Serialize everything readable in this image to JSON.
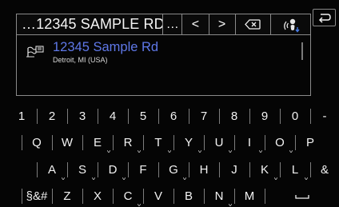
{
  "search": {
    "text": "…12345 SAMPLE RD ",
    "trail": "…",
    "prev_label": "<",
    "next_label": ">"
  },
  "results": [
    {
      "name": "12345 Sample Rd",
      "address": "Detroit, MI (USA)"
    }
  ],
  "keyboard": {
    "row1": [
      "1",
      "2",
      "3",
      "4",
      "5",
      "6",
      "7",
      "8",
      "9",
      "0",
      "-"
    ],
    "row2": [
      "Q",
      "W",
      "E",
      "R",
      "T",
      "Y",
      "U",
      "I",
      "O",
      "P"
    ],
    "row3": [
      "A",
      "S",
      "D",
      "F",
      "G",
      "H",
      "J",
      "K",
      "L",
      "&"
    ],
    "row4": [
      "§&#",
      "Z",
      "X",
      "C",
      "V",
      "B",
      "N",
      "M"
    ]
  },
  "colors": {
    "background": "#050505",
    "result_name": "#5f78e8",
    "border": "#8a8a8a"
  },
  "icons": {
    "backspace": "backspace-icon",
    "voice": "voice-input-icon",
    "back": "back-arrow-icon",
    "result": "address-flag-icon",
    "space": "space-bar-icon"
  }
}
